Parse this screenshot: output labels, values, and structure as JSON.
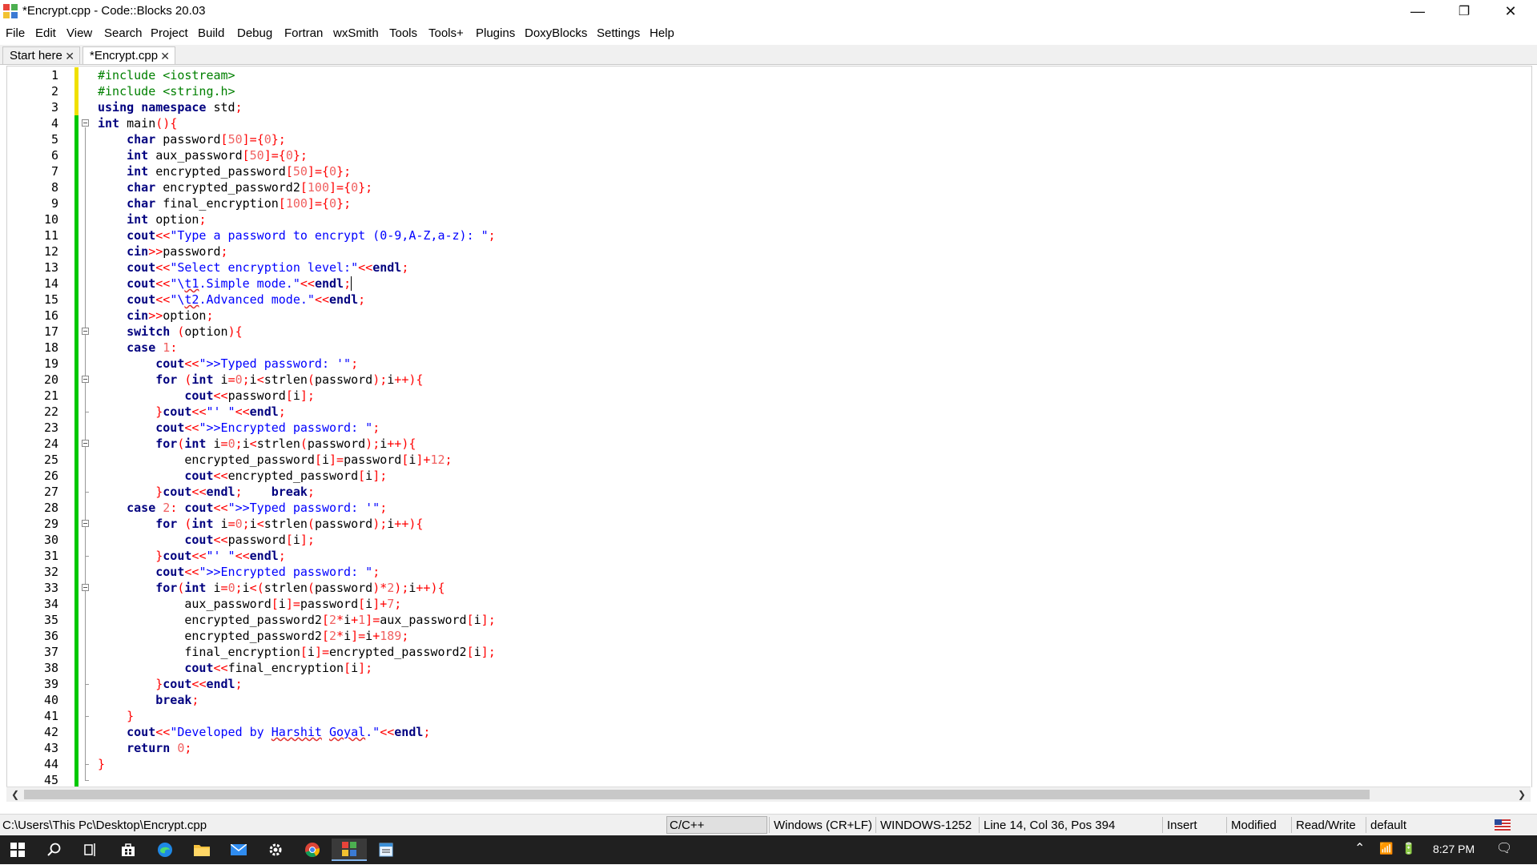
{
  "window": {
    "title": "*Encrypt.cpp - Code::Blocks 20.03",
    "minimize_glyph": "—",
    "restore_glyph": "❐",
    "close_glyph": "✕"
  },
  "menu": [
    "File",
    "Edit",
    "View",
    "Search",
    "Project",
    "Build",
    "Debug",
    "Fortran",
    "wxSmith",
    "Tools",
    "Tools+",
    "Plugins",
    "DoxyBlocks",
    "Settings",
    "Help"
  ],
  "tabs": [
    {
      "label": "Start here",
      "active": false
    },
    {
      "label": "*Encrypt.cpp",
      "active": true
    }
  ],
  "tab_close_glyph": "✕",
  "editor": {
    "line_numbers": [
      "1",
      "2",
      "3",
      "4",
      "5",
      "6",
      "7",
      "8",
      "9",
      "10",
      "11",
      "12",
      "13",
      "14",
      "15",
      "16",
      "17",
      "18",
      "19",
      "20",
      "21",
      "22",
      "23",
      "24",
      "25",
      "26",
      "27",
      "28",
      "29",
      "30",
      "31",
      "32",
      "33",
      "34",
      "35",
      "36",
      "37",
      "38",
      "39",
      "40",
      "41",
      "42",
      "43",
      "44",
      "45"
    ],
    "code": [
      "#include <iostream>",
      "#include <string.h>",
      "using namespace std;",
      "int main(){",
      "    char password[50]={0};",
      "    int aux_password[50]={0};",
      "    int encrypted_password[50]={0};",
      "    char encrypted_password2[100]={0};",
      "    char final_encryption[100]={0};",
      "    int option;",
      "    cout<<\"Type a password to encrypt (0-9,A-Z,a-z): \";",
      "    cin>>password;",
      "    cout<<\"Select encryption level:\"<<endl;",
      "    cout<<\"\\t1.Simple mode.\"<<endl;",
      "    cout<<\"\\t2.Advanced mode.\"<<endl;",
      "    cin>>option;",
      "    switch (option){",
      "    case 1:",
      "        cout<<\">>Typed password: '\";",
      "        for (int i=0;i<strlen(password);i++){",
      "            cout<<password[i];",
      "        }cout<<\"' \"<<endl;",
      "        cout<<\">>Encrypted password: \";",
      "        for(int i=0;i<strlen(password);i++){",
      "            encrypted_password[i]=password[i]+12;",
      "            cout<<encrypted_password[i];",
      "        }cout<<endl;    break;",
      "    case 2: cout<<\">>Typed password: '\";",
      "        for (int i=0;i<strlen(password);i++){",
      "            cout<<password[i];",
      "        }cout<<\"' \"<<endl;",
      "        cout<<\">>Encrypted password: \";",
      "        for(int i=0;i<(strlen(password)*2);i++){",
      "            aux_password[i]=password[i]+7;",
      "            encrypted_password2[2*i+1]=aux_password[i];",
      "            encrypted_password2[2*i]=i+189;",
      "            final_encryption[i]=encrypted_password2[i];",
      "            cout<<final_encryption[i];",
      "        }cout<<endl;",
      "        break;",
      "    }",
      "    cout<<\"Developed by Harshit Goyal.\"<<endl;",
      "    return 0;",
      "}",
      ""
    ],
    "keywords": [
      "using",
      "namespace",
      "int",
      "char",
      "for",
      "switch",
      "case",
      "break",
      "return",
      "cout",
      "cin",
      "endl"
    ],
    "fold_markers": [
      4,
      17,
      20,
      24,
      29,
      33
    ],
    "fold_ends": [
      22,
      27,
      31,
      39,
      41,
      44,
      45
    ],
    "cursor": {
      "line": 14,
      "col": 36
    },
    "colors": {
      "keyword": "#00007f",
      "preprocessor": "#008000",
      "string": "#0000ff",
      "number": "#f06060",
      "operator": "#ff0000",
      "saved_bar": "#00c800",
      "unsaved_bar": "#f0e000"
    }
  },
  "scroll": {
    "left_glyph": "❮",
    "right_glyph": "❯"
  },
  "status": {
    "path": "C:\\Users\\This Pc\\Desktop\\Encrypt.cpp",
    "language": "C/C++",
    "eol": "Windows (CR+LF)",
    "encoding": "WINDOWS-1252",
    "position": "Line 14, Col 36, Pos 394",
    "mode": "Insert",
    "modified": "Modified",
    "access": "Read/Write",
    "profile": "default"
  },
  "taskbar": {
    "time": "8:27 PM",
    "apps": [
      "start-icon",
      "search-icon",
      "task-view-icon",
      "store-icon",
      "edge-icon",
      "file-explorer-icon",
      "mail-icon",
      "settings-icon",
      "chrome-icon",
      "codeblocks-icon",
      "notepad-icon"
    ],
    "tray_glyphs": {
      "chevron": "⌃",
      "wifi": "📶",
      "battery": "🔋",
      "notifications": "🗨"
    }
  }
}
